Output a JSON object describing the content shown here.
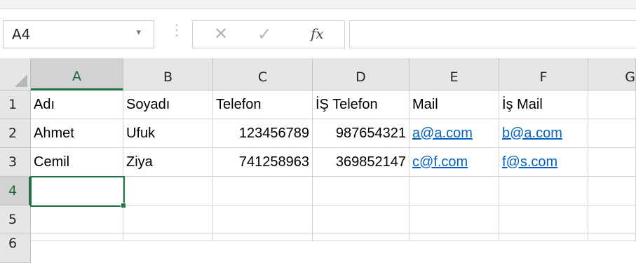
{
  "formula_bar": {
    "name_box": "A4",
    "name_box_arrow": "▾",
    "separator": "⋮",
    "cancel_glyph": "✕",
    "enter_glyph": "✓",
    "fx_label": "fx",
    "formula_value": ""
  },
  "columns": [
    "A",
    "B",
    "C",
    "D",
    "E",
    "F",
    "G"
  ],
  "rows": [
    "1",
    "2",
    "3",
    "4",
    "5",
    "6"
  ],
  "cells": {
    "r1": [
      "Adı",
      "Soyadı",
      "Telefon",
      "İŞ Telefon",
      "Mail",
      "İş Mail",
      ""
    ],
    "r2": [
      "Ahmet",
      "Ufuk",
      "123456789",
      "987654321",
      "a@a.com",
      "b@a.com",
      ""
    ],
    "r3": [
      "Cemil",
      "Ziya",
      "741258963",
      "369852147",
      "c@f.com",
      "f@s.com",
      ""
    ],
    "r4": [
      "",
      "",
      "",
      "",
      "",
      "",
      ""
    ],
    "r5": [
      "",
      "",
      "",
      "",
      "",
      "",
      ""
    ]
  },
  "selected_cell": "A4",
  "colors": {
    "accent": "#217346",
    "hyperlink": "#0563c1",
    "header_bg": "#e6e6e6"
  }
}
